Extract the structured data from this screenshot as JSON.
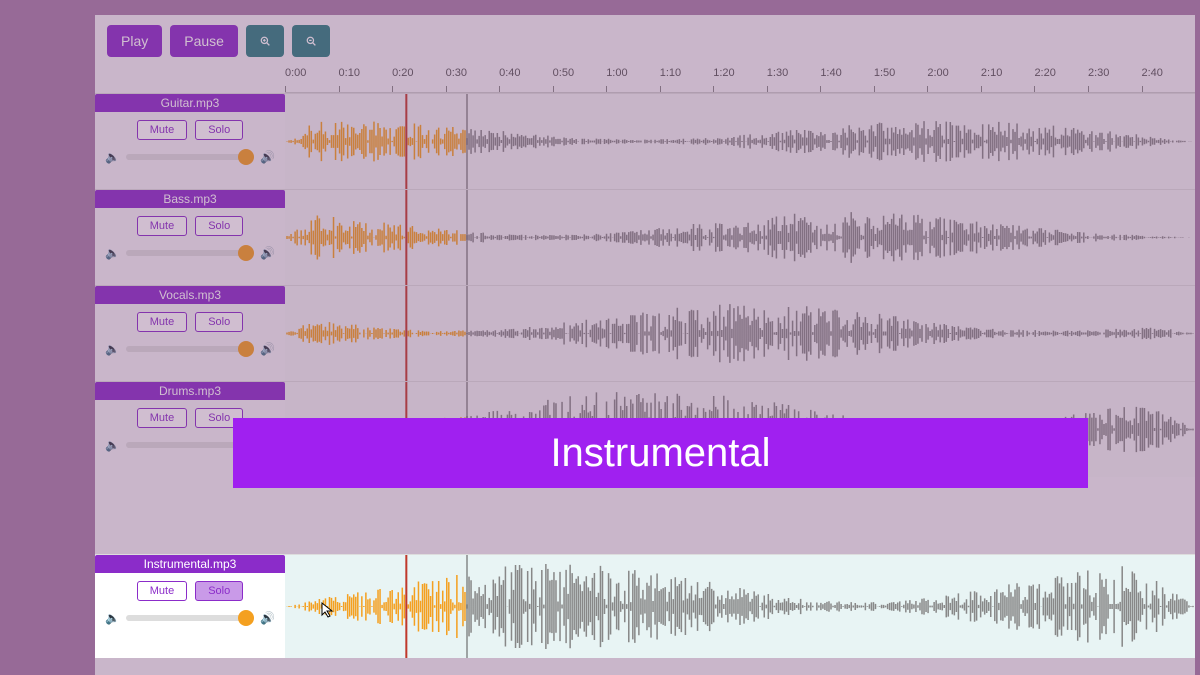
{
  "toolbar": {
    "play": "Play",
    "pause": "Pause"
  },
  "ruler": [
    "0:00",
    "0:10",
    "0:20",
    "0:30",
    "0:40",
    "0:50",
    "1:00",
    "1:10",
    "1:20",
    "1:30",
    "1:40",
    "1:50",
    "2:00",
    "2:10",
    "2:20",
    "2:30",
    "2:40"
  ],
  "tracks": [
    {
      "name": "Guitar.mp3",
      "mute": "Mute",
      "solo": "Solo",
      "seed": 1,
      "density": 0.5
    },
    {
      "name": "Bass.mp3",
      "mute": "Mute",
      "solo": "Solo",
      "seed": 2,
      "density": 0.6
    },
    {
      "name": "Vocals.mp3",
      "mute": "Mute",
      "solo": "Solo",
      "seed": 3,
      "density": 0.7
    },
    {
      "name": "Drums.mp3",
      "mute": "Mute",
      "solo": "Solo",
      "seed": 4,
      "density": 0.95
    }
  ],
  "selected_track": {
    "name": "Instrumental.mp3",
    "mute": "Mute",
    "solo": "Solo",
    "seed": 5,
    "density": 0.95
  },
  "overlay_label": "Instrumental",
  "colors": {
    "accent": "#8b2cc9",
    "highlight": "#f4a020",
    "wave_fg": "#f4a020",
    "wave_bg": "#888"
  }
}
